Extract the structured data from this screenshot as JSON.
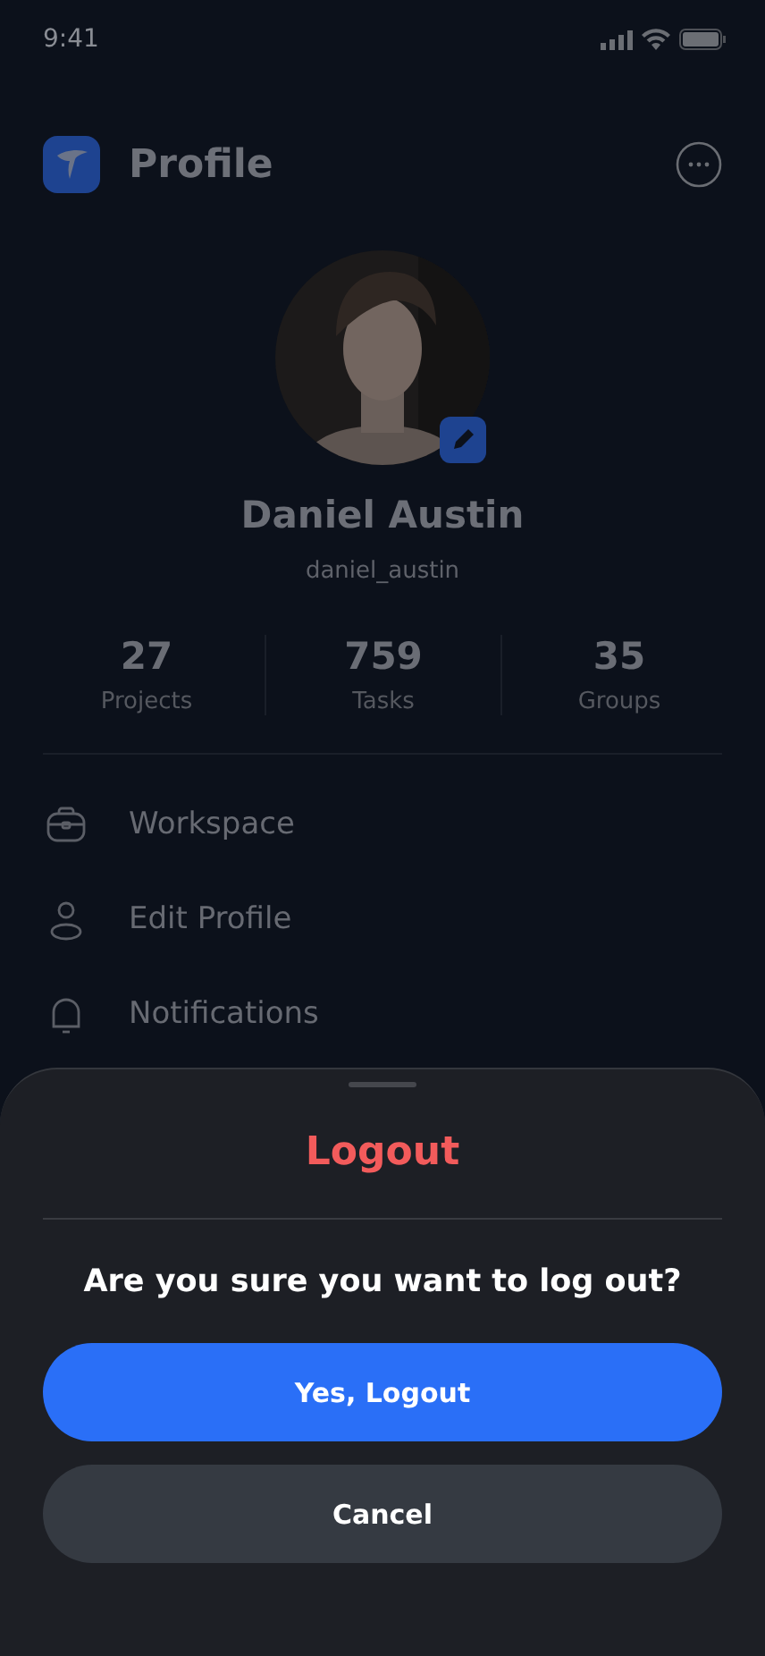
{
  "status_bar": {
    "time": "9:41"
  },
  "header": {
    "title": "Profile"
  },
  "profile": {
    "name": "Daniel Austin",
    "username": "daniel_austin"
  },
  "stats": [
    {
      "value": "27",
      "label": "Projects"
    },
    {
      "value": "759",
      "label": "Tasks"
    },
    {
      "value": "35",
      "label": "Groups"
    }
  ],
  "menu": [
    {
      "label": "Workspace"
    },
    {
      "label": "Edit Profile"
    },
    {
      "label": "Notifications"
    }
  ],
  "dialog": {
    "title": "Logout",
    "message": "Are you sure you want to log out?",
    "buttons": [
      {
        "label": "Yes, Logout",
        "kind": "primary"
      },
      {
        "label": "Cancel",
        "kind": "secondary"
      }
    ]
  }
}
